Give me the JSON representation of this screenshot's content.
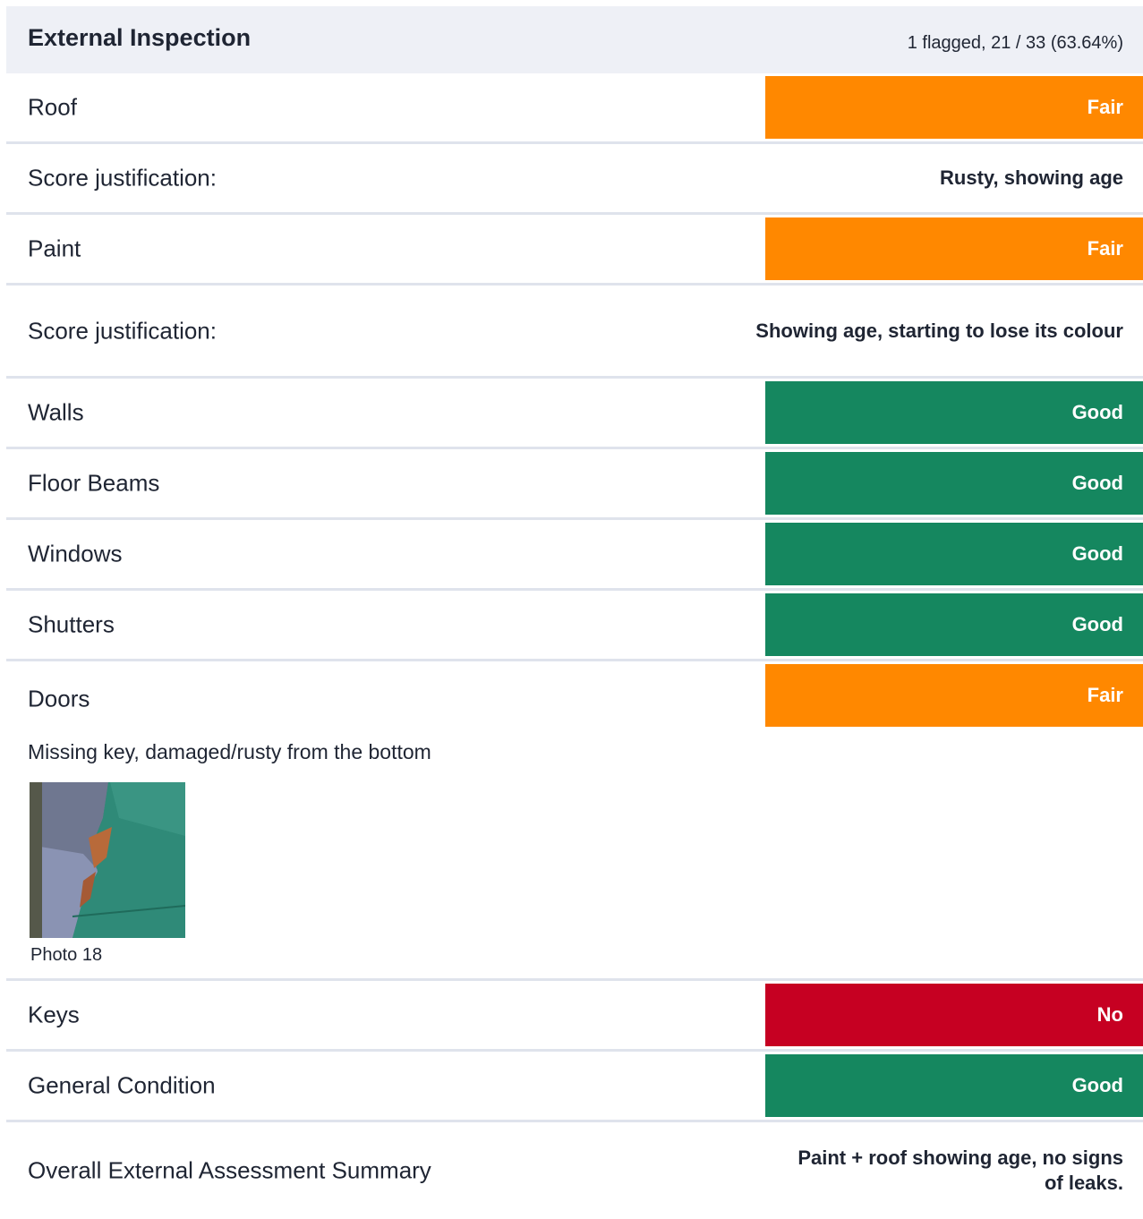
{
  "header": {
    "title": "External Inspection",
    "progress": "1 flagged, 21 / 33 (63.64%)"
  },
  "colors": {
    "fair": "#ff8800",
    "good": "#15875f",
    "no": "#c60022"
  },
  "rows": {
    "roof": {
      "label": "Roof",
      "value": "Fair"
    },
    "roof_just": {
      "label": "Score justification:",
      "value": "Rusty, showing age"
    },
    "paint": {
      "label": "Paint",
      "value": "Fair"
    },
    "paint_just": {
      "label": "Score justification:",
      "value": "Showing age, starting to lose its colour"
    },
    "walls": {
      "label": "Walls",
      "value": "Good"
    },
    "floor_beams": {
      "label": "Floor Beams",
      "value": "Good"
    },
    "windows": {
      "label": "Windows",
      "value": "Good"
    },
    "shutters": {
      "label": "Shutters",
      "value": "Good"
    },
    "doors": {
      "label": "Doors",
      "value": "Fair",
      "note": "Missing key, damaged/rusty from the bottom",
      "photo_caption": "Photo 18"
    },
    "keys": {
      "label": "Keys",
      "value": "No"
    },
    "general": {
      "label": "General Condition",
      "value": "Good"
    },
    "summary": {
      "label": "Overall External Assessment Summary",
      "value": "Paint + roof showing age, no signs of leaks."
    }
  }
}
